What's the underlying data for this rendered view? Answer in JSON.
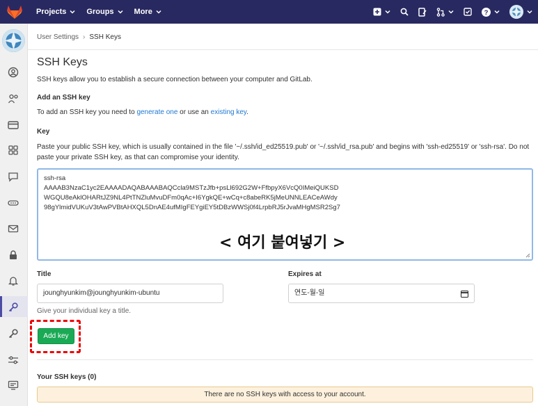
{
  "nav": {
    "items": [
      {
        "label": "Projects"
      },
      {
        "label": "Groups"
      },
      {
        "label": "More"
      }
    ]
  },
  "breadcrumb": {
    "parent": "User Settings",
    "current": "SSH Keys"
  },
  "page": {
    "title": "SSH Keys",
    "description": "SSH keys allow you to establish a secure connection between your computer and GitLab.",
    "add_heading": "Add an SSH key",
    "add_text_before": "To add an SSH key you need to ",
    "add_link_generate": "generate one",
    "add_text_mid": " or use an ",
    "add_link_existing": "existing key",
    "add_text_after": "."
  },
  "form": {
    "key_label": "Key",
    "key_help": "Paste your public SSH key, which is usually contained in the file '~/.ssh/id_ed25519.pub' or '~/.ssh/id_rsa.pub' and begins with 'ssh-ed25519' or 'ssh-rsa'. Do not paste your private SSH key, as that can compromise your identity.",
    "key_lines": [
      "ssh-rsa",
      "AAAAB3NzaC1yc2EAAAADAQABAAABAQCcla9MSTzJfb+psLl692G2W+FfbpyX6VcQ0IMeiQUKSD",
      "WGQU8eAklOHARtJZ9NL4PtTNZluMvuDFm0qAc+I6YgkQE+wCq+c8abeRK5jMeUNNLEACeAWdy",
      "98gYlmidVUKuV3tAwPVBtAHXQL5DnAE4ufMIgFEYgiEY5tDBzWWSj0f4LrpbRJ5rJvaMHgMSR2Sg7"
    ],
    "annotation": "< 여기 붙여넣기 >",
    "title_label": "Title",
    "title_value": "jounghyunkim@jounghyunkim-ubuntu",
    "title_hint": "Give your individual key a title.",
    "expires_label": "Expires at",
    "expires_value": "연도-월-일",
    "add_button": "Add key"
  },
  "keys": {
    "heading": "Your SSH keys (0)",
    "empty": "There are no SSH keys with access to your account."
  },
  "colors": {
    "navbar": "#292961",
    "button": "#1aaa55",
    "link": "#1f78d1",
    "notice_bg": "#fdf1dd",
    "highlight": "#ee0000"
  }
}
